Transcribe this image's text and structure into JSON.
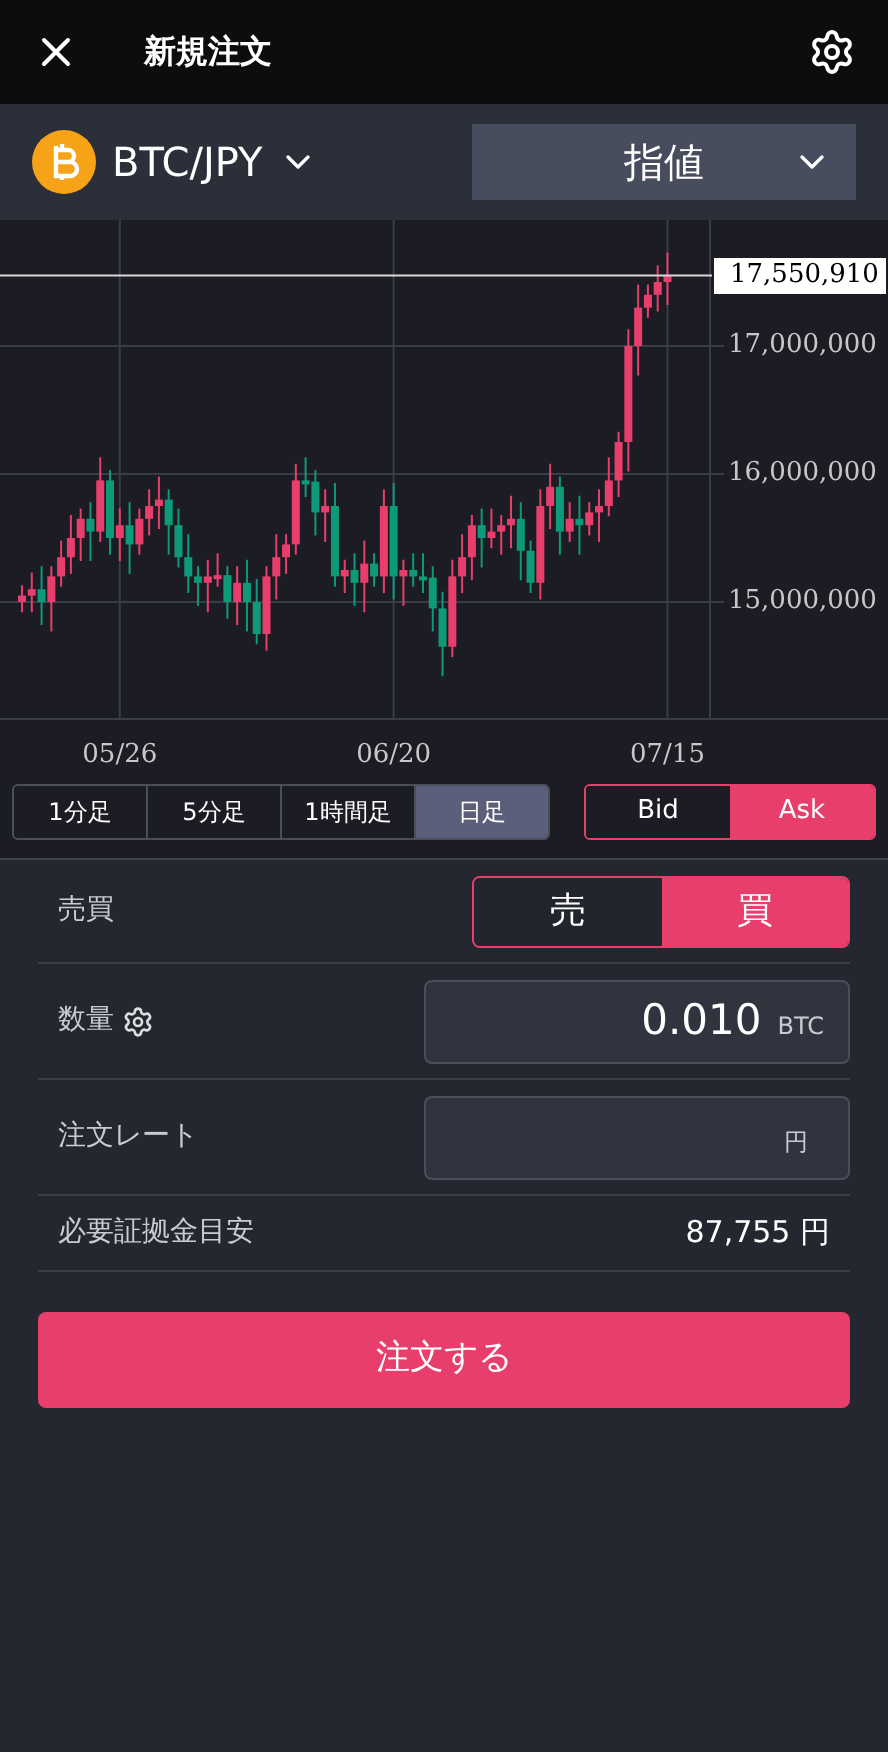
{
  "header": {
    "title": "新規注文"
  },
  "instrument": {
    "symbol": "BTC/JPY",
    "order_type": "指値"
  },
  "chart": {
    "chart_data": {
      "type": "candlestick",
      "grid": true,
      "ref_lines": [
        {
          "axis": "y",
          "value": 17550910,
          "label": "17,550,910"
        }
      ],
      "categories": [
        null,
        null,
        null,
        null,
        null,
        null,
        null,
        null,
        null,
        null,
        "05/26",
        null,
        null,
        null,
        null,
        null,
        null,
        null,
        null,
        null,
        null,
        null,
        null,
        null,
        null,
        null,
        null,
        null,
        null,
        null,
        null,
        null,
        null,
        null,
        null,
        null,
        null,
        null,
        "06/20",
        null,
        null,
        null,
        null,
        null,
        null,
        null,
        null,
        null,
        null,
        null,
        null,
        null,
        null,
        null,
        null,
        null,
        null,
        null,
        null,
        null,
        null,
        null,
        null,
        null,
        null,
        null,
        "07/15"
      ],
      "ohlc": [
        [
          15000000,
          15130000,
          14920000,
          15050000
        ],
        [
          15050000,
          15230000,
          14920000,
          15100000
        ],
        [
          15100000,
          15280000,
          14820000,
          15000000
        ],
        [
          15000000,
          15280000,
          14770000,
          15200000
        ],
        [
          15200000,
          15480000,
          15120000,
          15350000
        ],
        [
          15350000,
          15680000,
          15220000,
          15500000
        ],
        [
          15500000,
          15730000,
          15320000,
          15650000
        ],
        [
          15650000,
          15780000,
          15320000,
          15550000
        ],
        [
          15550000,
          16130000,
          15470000,
          15950000
        ],
        [
          15950000,
          16030000,
          15370000,
          15500000
        ],
        [
          15500000,
          15730000,
          15320000,
          15600000
        ],
        [
          15600000,
          15780000,
          15220000,
          15450000
        ],
        [
          15450000,
          15730000,
          15370000,
          15650000
        ],
        [
          15650000,
          15880000,
          15520000,
          15750000
        ],
        [
          15750000,
          15980000,
          15570000,
          15800000
        ],
        [
          15800000,
          15880000,
          15370000,
          15600000
        ],
        [
          15600000,
          15730000,
          15270000,
          15350000
        ],
        [
          15350000,
          15530000,
          15070000,
          15200000
        ],
        [
          15200000,
          15280000,
          14970000,
          15150000
        ],
        [
          15150000,
          15330000,
          14920000,
          15200000
        ],
        [
          15200000,
          15380000,
          15120000,
          15210000
        ],
        [
          15210000,
          15280000,
          14870000,
          15000000
        ],
        [
          15000000,
          15280000,
          14820000,
          15150000
        ],
        [
          15150000,
          15330000,
          14770000,
          15000000
        ],
        [
          15000000,
          15180000,
          14670000,
          14750000
        ],
        [
          14750000,
          15280000,
          14620000,
          15200000
        ],
        [
          15200000,
          15530000,
          15020000,
          15350000
        ],
        [
          15350000,
          15530000,
          15220000,
          15450000
        ],
        [
          15450000,
          16080000,
          15370000,
          15950000
        ],
        [
          15950000,
          16130000,
          15820000,
          15940000
        ],
        [
          15940000,
          16030000,
          15520000,
          15700000
        ],
        [
          15700000,
          15880000,
          15470000,
          15750000
        ],
        [
          15750000,
          15930000,
          15120000,
          15200000
        ],
        [
          15200000,
          15330000,
          15070000,
          15250000
        ],
        [
          15250000,
          15380000,
          14970000,
          15150000
        ],
        [
          15150000,
          15480000,
          14920000,
          15300000
        ],
        [
          15300000,
          15380000,
          15120000,
          15200000
        ],
        [
          15200000,
          15880000,
          15070000,
          15750000
        ],
        [
          15750000,
          15930000,
          15020000,
          15200000
        ],
        [
          15200000,
          15330000,
          14970000,
          15250000
        ],
        [
          15250000,
          15380000,
          15120000,
          15200000
        ],
        [
          15200000,
          15380000,
          15070000,
          15190000
        ],
        [
          15190000,
          15280000,
          14770000,
          14950000
        ],
        [
          14950000,
          15080000,
          14420000,
          14650000
        ],
        [
          14650000,
          15330000,
          14570000,
          15200000
        ],
        [
          15200000,
          15530000,
          15070000,
          15350000
        ],
        [
          15350000,
          15680000,
          15170000,
          15600000
        ],
        [
          15600000,
          15730000,
          15270000,
          15500000
        ],
        [
          15500000,
          15730000,
          15420000,
          15550000
        ],
        [
          15550000,
          15680000,
          15370000,
          15600000
        ],
        [
          15600000,
          15830000,
          15420000,
          15650000
        ],
        [
          15650000,
          15780000,
          15170000,
          15400000
        ],
        [
          15400000,
          15480000,
          15070000,
          15150000
        ],
        [
          15150000,
          15880000,
          15020000,
          15750000
        ],
        [
          15750000,
          16080000,
          15570000,
          15900000
        ],
        [
          15900000,
          15980000,
          15370000,
          15550000
        ],
        [
          15550000,
          15780000,
          15470000,
          15650000
        ],
        [
          15650000,
          15830000,
          15370000,
          15600000
        ],
        [
          15600000,
          15780000,
          15520000,
          15700000
        ],
        [
          15700000,
          15880000,
          15470000,
          15750000
        ],
        [
          15750000,
          16130000,
          15670000,
          15950000
        ],
        [
          15950000,
          16330000,
          15820000,
          16250000
        ],
        [
          16250000,
          17130000,
          16020000,
          17000000
        ],
        [
          17000000,
          17480000,
          16770000,
          17300000
        ],
        [
          17300000,
          17480000,
          17220000,
          17400000
        ],
        [
          17400000,
          17630000,
          17270000,
          17500000
        ],
        [
          17500000,
          17730000,
          17320000,
          17550000
        ]
      ],
      "ylim": [
        14078125,
        17984375
      ],
      "yticks": [
        {
          "value": 17000000,
          "label": "17,000,000"
        },
        {
          "value": 16000000,
          "label": "16,000,000"
        },
        {
          "value": 15000000,
          "label": "15,000,000"
        }
      ]
    }
  },
  "timeframes": [
    {
      "label": "1分足",
      "selected": false
    },
    {
      "label": "5分足",
      "selected": false
    },
    {
      "label": "1時間足",
      "selected": false
    },
    {
      "label": "日足",
      "selected": true
    }
  ],
  "price_sides": [
    {
      "label": "Bid",
      "selected": false
    },
    {
      "label": "Ask",
      "selected": true
    }
  ],
  "form": {
    "side": {
      "label": "売買",
      "options": [
        {
          "label": "売",
          "selected": false
        },
        {
          "label": "買",
          "selected": true
        }
      ]
    },
    "quantity": {
      "label": "数量",
      "value": "0.010",
      "unit": "BTC"
    },
    "rate": {
      "label": "注文レート",
      "unit": "円"
    },
    "margin": {
      "label": "必要証拠金目安",
      "value": "87,755 円"
    }
  },
  "submit": "注文する"
}
